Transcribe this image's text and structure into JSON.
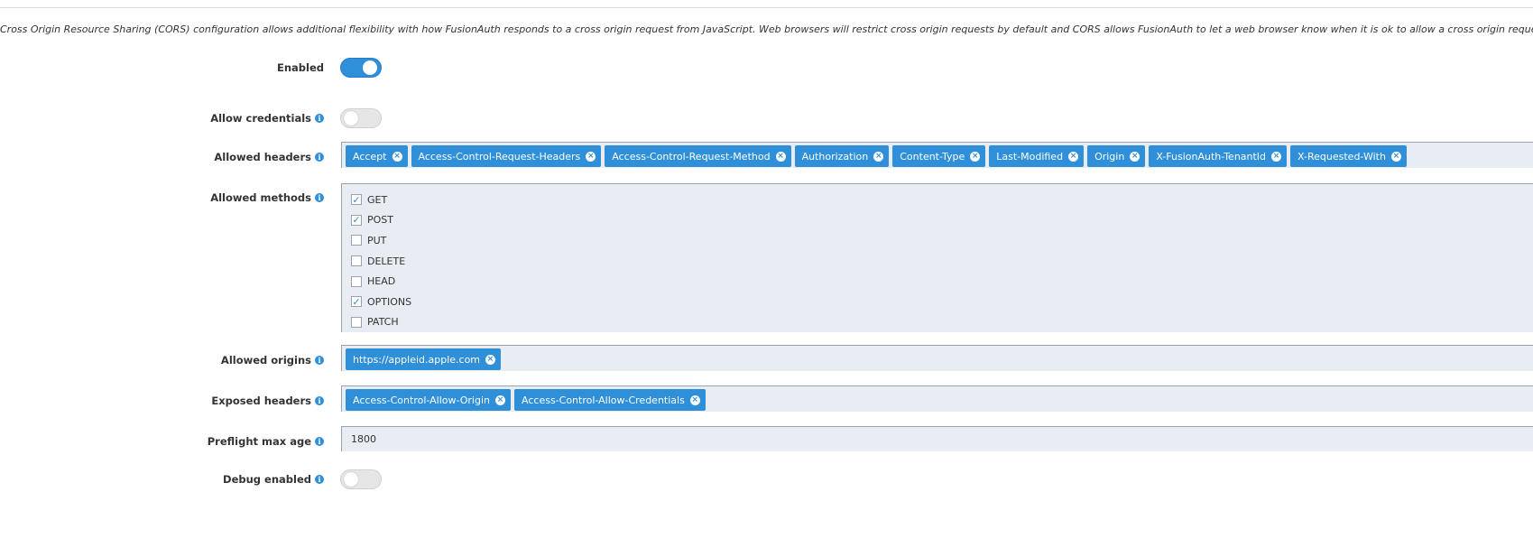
{
  "description": "Cross Origin Resource Sharing (CORS) configuration allows additional flexibility with how FusionAuth responds to a cross origin request from JavaScript. Web browsers will restrict cross origin requests by default and CORS allows FusionAuth to let a web browser know when it is ok to allow a cross origin request.",
  "enabled": {
    "label": "Enabled",
    "value": true
  },
  "allow_credentials": {
    "label": "Allow credentials",
    "value": false
  },
  "allowed_headers": {
    "label": "Allowed headers",
    "tags": [
      "Accept",
      "Access-Control-Request-Headers",
      "Access-Control-Request-Method",
      "Authorization",
      "Content-Type",
      "Last-Modified",
      "Origin",
      "X-FusionAuth-TenantId",
      "X-Requested-With"
    ]
  },
  "allowed_methods": {
    "label": "Allowed methods",
    "options": [
      {
        "name": "GET",
        "checked": true
      },
      {
        "name": "POST",
        "checked": true
      },
      {
        "name": "PUT",
        "checked": false
      },
      {
        "name": "DELETE",
        "checked": false
      },
      {
        "name": "HEAD",
        "checked": false
      },
      {
        "name": "OPTIONS",
        "checked": true
      },
      {
        "name": "PATCH",
        "checked": false
      }
    ]
  },
  "allowed_origins": {
    "label": "Allowed origins",
    "tags": [
      "https://appleid.apple.com"
    ]
  },
  "exposed_headers": {
    "label": "Exposed headers",
    "tags": [
      "Access-Control-Allow-Origin",
      "Access-Control-Allow-Credentials"
    ]
  },
  "preflight_max_age": {
    "label": "Preflight max age",
    "value": "1800"
  },
  "debug_enabled": {
    "label": "Debug enabled",
    "value": false
  },
  "colors": {
    "accent": "#2f8fd9",
    "field_bg": "#e8edf3"
  },
  "icons": {
    "info": "info-icon",
    "remove": "close-circle-icon",
    "check": "check-icon"
  }
}
